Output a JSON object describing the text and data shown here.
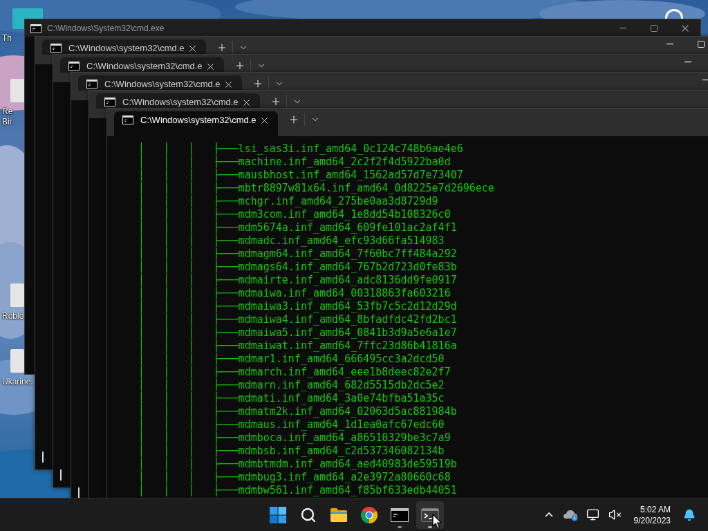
{
  "desktop": {
    "icons": [
      {
        "lines": [
          "Th"
        ],
        "color": "#2bb5c4"
      },
      {
        "lines": [
          "Re",
          "Bir"
        ],
        "color": "#e6e6e6"
      },
      {
        "lines": [
          "Roblo"
        ],
        "color": "#e6e6e6"
      },
      {
        "lines": [
          "Ukarine."
        ],
        "color": "#e6e6e6"
      }
    ]
  },
  "console_window": {
    "title": "C:\\Windows\\System32\\cmd.exe"
  },
  "stacked_windows": [
    {
      "tab_title": "C:\\Windows\\system32\\cmd.e"
    },
    {
      "tab_title": "C:\\Windows\\system32\\cmd.e"
    },
    {
      "tab_title": "C:\\Windows\\system32\\cmd.e"
    },
    {
      "tab_title": "C:\\Windows\\system32\\cmd.e"
    }
  ],
  "terminal": {
    "tab_title": "C:\\Windows\\system32\\cmd.e",
    "lines": [
      "    │   │   │   ├───lsi_sas3i.inf_amd64_0c124c748b6ae4e6",
      "    │   │   │   ├───machine.inf_amd64_2c2f2f4d5922ba0d",
      "    │   │   │   ├───mausbhost.inf_amd64_1562ad57d7e73407",
      "    │   │   │   ├───mbtr8897w81x64.inf_amd64_0d8225e7d2696ece",
      "    │   │   │   ├───mchgr.inf_amd64_275be0aa3d8729d9",
      "    │   │   │   ├───mdm3com.inf_amd64_1e8dd54b108326c0",
      "    │   │   │   ├───mdm5674a.inf_amd64_609fe101ac2af4f1",
      "    │   │   │   ├───mdmadc.inf_amd64_efc93d66fa514983",
      "    │   │   │   ├───mdmagm64.inf_amd64_7f60bc7ff484a292",
      "    │   │   │   ├───mdmags64.inf_amd64_767b2d723d0fe83b",
      "    │   │   │   ├───mdmairte.inf_amd64_adc8136dd9fe0917",
      "    │   │   │   ├───mdmaiwa.inf_amd64_00318863fa603216",
      "    │   │   │   ├───mdmaiwa3.inf_amd64_53fb7c5c2d12d29d",
      "    │   │   │   ├───mdmaiwa4.inf_amd64_8bfadfdc42fd2bc1",
      "    │   │   │   ├───mdmaiwa5.inf_amd64_0841b3d9a5e6a1e7",
      "    │   │   │   ├───mdmaiwat.inf_amd64_7ffc23d86b41816a",
      "    │   │   │   ├───mdmar1.inf_amd64_666495cc3a2dcd50",
      "    │   │   │   ├───mdmarch.inf_amd64_eee1b8deec82e2f7",
      "    │   │   │   ├───mdmarn.inf_amd64_682d5515db2dc5e2",
      "    │   │   │   ├───mdmati.inf_amd64_3a0e74bfba51a35c",
      "    │   │   │   ├───mdmatm2k.inf_amd64_02063d5ac881984b",
      "    │   │   │   ├───mdmaus.inf_amd64_1d1ea0afc67edc60",
      "    │   │   │   ├───mdmboca.inf_amd64_a86510329be3c7a9",
      "    │   │   │   ├───mdmbsb.inf_amd64_c2d537346082134b",
      "    │   │   │   ├───mdmbtmdm.inf_amd64_aed40983de59519b",
      "    │   │   │   ├───mdmbug3.inf_amd64_a2e3972a80660c68",
      "    │   │   │   ├───mdmbw561.inf_amd64_f85bf633edb44051"
    ]
  },
  "taskbar": {
    "apps": [
      {
        "kind": "start",
        "running": false,
        "selected": false
      },
      {
        "kind": "search",
        "running": false,
        "selected": false
      },
      {
        "kind": "explorer",
        "running": false,
        "selected": false
      },
      {
        "kind": "browser",
        "running": false,
        "selected": false
      },
      {
        "kind": "console",
        "running": true,
        "selected": false
      },
      {
        "kind": "terminal",
        "running": true,
        "selected": true
      }
    ],
    "tray": {
      "time": "5:02 AM",
      "date": "9/20/2023"
    }
  }
}
